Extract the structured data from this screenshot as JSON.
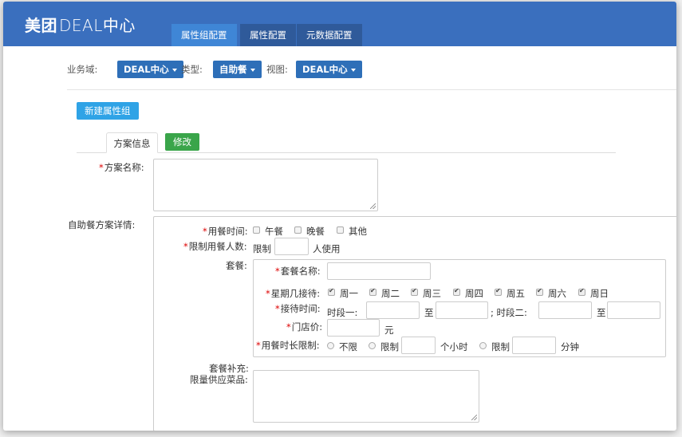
{
  "header": {
    "brand_bold": "美团",
    "brand_light": "DEAL中心",
    "tabs": [
      "属性组配置",
      "属性配置",
      "元数据配置"
    ]
  },
  "filters": {
    "domain_label": "业务域:",
    "domain_value": "DEAL中心",
    "type_label": "类型:",
    "type_value": "自助餐",
    "view_label": "视图:",
    "view_value": "DEAL中心"
  },
  "actions": {
    "new_group": "新建属性组",
    "tab_info": "方案信息",
    "edit": "修改"
  },
  "form": {
    "req_mark": "*",
    "plan_name_label": "方案名称:",
    "detail_label": "自助餐方案详情:",
    "meal_time_label": "用餐时间:",
    "meal_time_options": [
      "午餐",
      "晚餐",
      "其他"
    ],
    "limit_people_label": "限制用餐人数:",
    "limit_prefix": "限制",
    "limit_suffix": "人使用",
    "package_label": "套餐:",
    "package_name_label": "套餐名称:",
    "weekday_label": "星期几接待:",
    "weekdays": [
      "周一",
      "周二",
      "周三",
      "周四",
      "周五",
      "周六",
      "周日"
    ],
    "reception_time_label": "接待时间:",
    "slot1": "时段一:",
    "to": "至",
    "slot2": "; 时段二:",
    "store_price_label": "门店价:",
    "yuan": "元",
    "duration_label": "用餐时长限制:",
    "unlimited": "不限",
    "limit": "限制",
    "hours": "个小时",
    "minutes": "分钟",
    "package_extra_label": "套餐补充:",
    "limited_dishes_label": "限量供应菜品:"
  },
  "colors": {
    "topbar": "#3a6fbe",
    "tab_active": "#3f86d6",
    "filter_btn": "#2e6fb8",
    "new_btn": "#2fa3e6",
    "edit_btn": "#3aa54a",
    "required": "#dd0000"
  }
}
